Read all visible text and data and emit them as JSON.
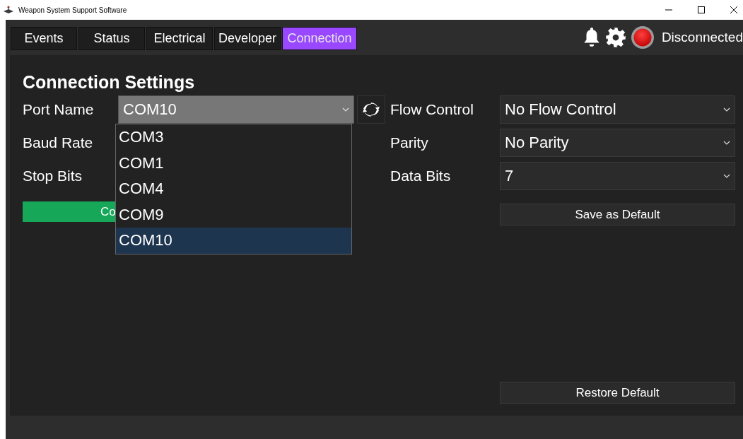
{
  "window": {
    "title": "Weapon System Support Software"
  },
  "tabs": [
    {
      "label": "Events",
      "selected": false
    },
    {
      "label": "Status",
      "selected": false
    },
    {
      "label": "Electrical",
      "selected": false
    },
    {
      "label": "Developer",
      "selected": false
    },
    {
      "label": "Connection",
      "selected": true
    }
  ],
  "status": {
    "label": "Disconnected"
  },
  "heading": "Connection Settings",
  "left_fields": [
    {
      "label": "Port Name",
      "value": "COM10",
      "open": true
    },
    {
      "label": "Baud Rate"
    },
    {
      "label": "Stop Bits"
    }
  ],
  "port_dropdown": [
    {
      "label": "COM3",
      "selected": false
    },
    {
      "label": "COM1",
      "selected": false
    },
    {
      "label": "COM4",
      "selected": false
    },
    {
      "label": "COM9",
      "selected": false
    },
    {
      "label": "COM10",
      "selected": true
    }
  ],
  "connect_button": {
    "label": "Co"
  },
  "right_fields": [
    {
      "label": "Flow Control",
      "value": "No Flow Control"
    },
    {
      "label": "Parity",
      "value": "No Parity"
    },
    {
      "label": "Data Bits",
      "value": "7"
    }
  ],
  "save_button": "Save as Default",
  "restore_button": "Restore Default"
}
